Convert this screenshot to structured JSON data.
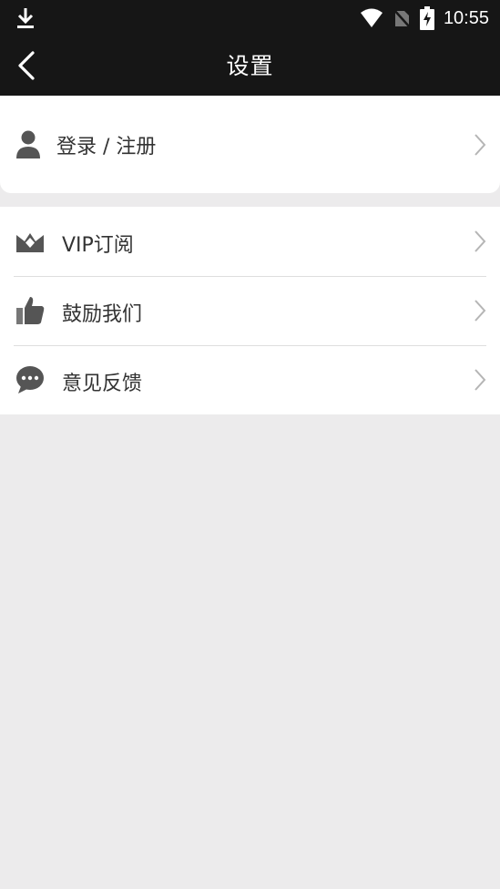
{
  "status_bar": {
    "time": "10:55",
    "icons": [
      "download-icon",
      "wifi-icon",
      "no-sim-icon",
      "battery-charging-icon"
    ]
  },
  "app_bar": {
    "title": "设置",
    "back_icon": "back-arrow-icon"
  },
  "login": {
    "label": "登录 / 注册",
    "icon": "user-icon"
  },
  "menu": {
    "items": [
      {
        "label": "VIP订阅",
        "icon": "vip-crown-icon"
      },
      {
        "label": "鼓励我们",
        "icon": "thumbs-up-icon"
      },
      {
        "label": "意见反馈",
        "icon": "chat-bubble-icon"
      }
    ]
  },
  "colors": {
    "bar_bg": "#161616",
    "page_bg": "#ecebec",
    "card_bg": "#ffffff",
    "text": "#333333",
    "icon": "#555555",
    "chevron": "#b5b5b5",
    "divider": "#dedede"
  }
}
